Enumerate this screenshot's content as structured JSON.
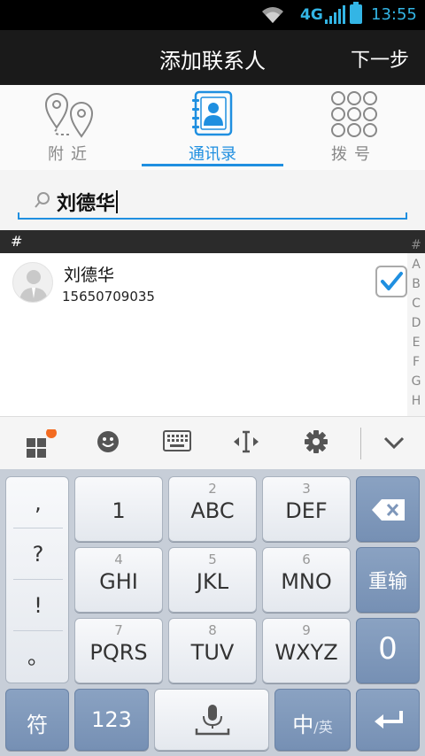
{
  "status": {
    "network": "4G",
    "time": "13:55"
  },
  "titlebar": {
    "title": "添加联系人",
    "next_label": "下一步"
  },
  "tabs": [
    {
      "label": "附近",
      "icon": "map-pin-icon",
      "active": false
    },
    {
      "label": "通讯录",
      "icon": "contacts-book-icon",
      "active": true
    },
    {
      "label": "拨号",
      "icon": "dialpad-icon",
      "active": false
    }
  ],
  "search": {
    "value": "刘德华"
  },
  "list": {
    "section": "#",
    "contacts": [
      {
        "name": "刘德华",
        "phone": "15650709035",
        "checked": true
      }
    ]
  },
  "index_bar": [
    "#",
    "A",
    "B",
    "C",
    "D",
    "E",
    "F",
    "G",
    "H"
  ],
  "keyboard": {
    "punct": [
      ",",
      "?",
      "!",
      "。"
    ],
    "keys": [
      {
        "sub": "",
        "main": "1"
      },
      {
        "sub": "2",
        "main": "ABC"
      },
      {
        "sub": "3",
        "main": "DEF"
      },
      {
        "sub": "4",
        "main": "GHI"
      },
      {
        "sub": "5",
        "main": "JKL"
      },
      {
        "sub": "6",
        "main": "MNO"
      },
      {
        "sub": "7",
        "main": "PQRS"
      },
      {
        "sub": "8",
        "main": "TUV"
      },
      {
        "sub": "9",
        "main": "WXYZ"
      }
    ],
    "reinput_label": "重输",
    "zero_label": "0",
    "symbol_label": "符",
    "num_label": "123",
    "lang_main": "中",
    "lang_sub": "/英"
  },
  "colors": {
    "accent": "#1f8fe0",
    "notification_dot": "#f36b21"
  }
}
